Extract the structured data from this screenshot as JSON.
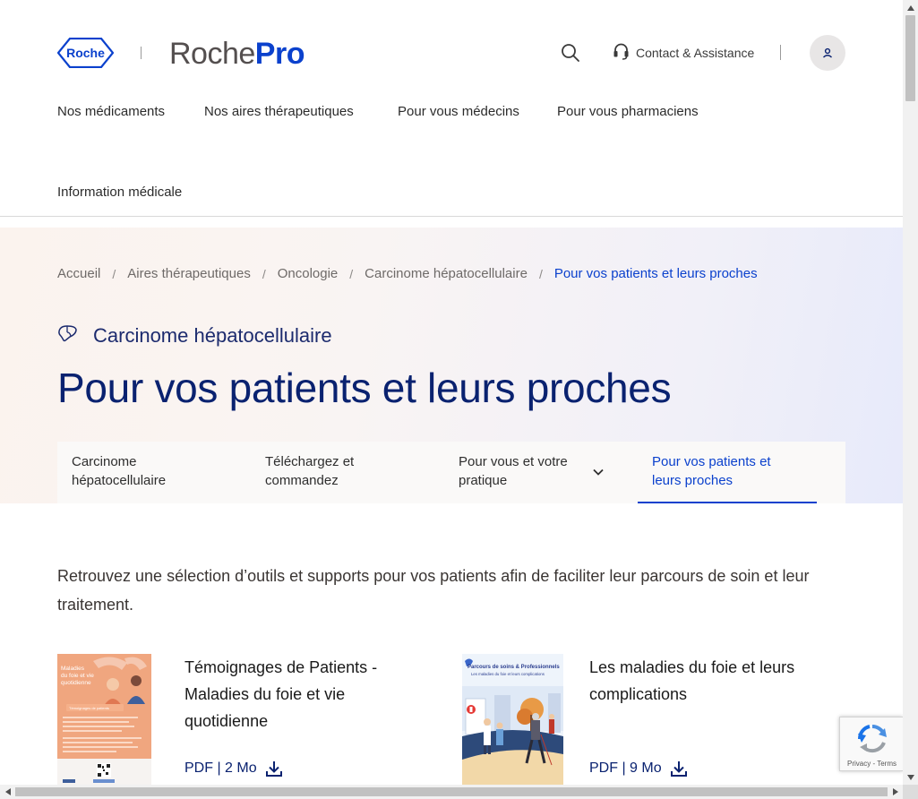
{
  "header": {
    "logo_text": "Roche",
    "brand_thin": "Roche",
    "brand_bold": "Pro",
    "contact_label": "Contact & Assistance",
    "nav": [
      {
        "label": "Nos médicaments"
      },
      {
        "label": "Nos aires thérapeutiques"
      },
      {
        "label": "Pour vous médecins"
      },
      {
        "label": "Pour vous pharmaciens"
      },
      {
        "label": "Information médicale"
      }
    ]
  },
  "breadcrumb": {
    "items": [
      "Accueil",
      "Aires thérapeutiques",
      "Oncologie",
      "Carcinome hépatocellulaire"
    ],
    "current": "Pour vos patients et leurs proches",
    "separator": "/"
  },
  "hero": {
    "area_label": "Carcinome hépatocellulaire",
    "area_icon": "liver-icon",
    "title": "Pour vos patients et leurs proches"
  },
  "tabs": [
    {
      "line1": "Carcinome",
      "line2": "hépatocellulaire"
    },
    {
      "line1": "Téléchargez et",
      "line2": "commandez"
    },
    {
      "line1": "Pour vous et votre",
      "line2": "pratique"
    },
    {
      "line1": "Pour vos patients et",
      "line2": "leurs proches",
      "active": true
    }
  ],
  "main": {
    "intro": "Retrouvez une sélection d’outils et supports pour vos patients afin de faciliter leur parcours de soin et leur traitement.",
    "cards": [
      {
        "title_lines": [
          "Témoignages de Patients -",
          "Maladies du foie et vie",
          "quotidienne"
        ],
        "file_label": "PDF | 2 Mo",
        "thumb": {
          "heading_lines": [
            "Maladies",
            "du foie et vie",
            "quotidienne"
          ],
          "badge": "Témoignages de patients"
        }
      },
      {
        "title_lines": [
          "Les maladies du foie et leurs",
          "complications"
        ],
        "file_label": "PDF | 9 Mo",
        "thumb": {
          "heading_line1": "Parcours de soins & Professionnels",
          "heading_line2": "Les maladies du foie et leurs complications"
        }
      }
    ]
  },
  "recaptcha": {
    "legal": "Privacy - Terms"
  },
  "colors": {
    "brand_blue": "#0b41cd",
    "title_navy": "#0a2270"
  }
}
